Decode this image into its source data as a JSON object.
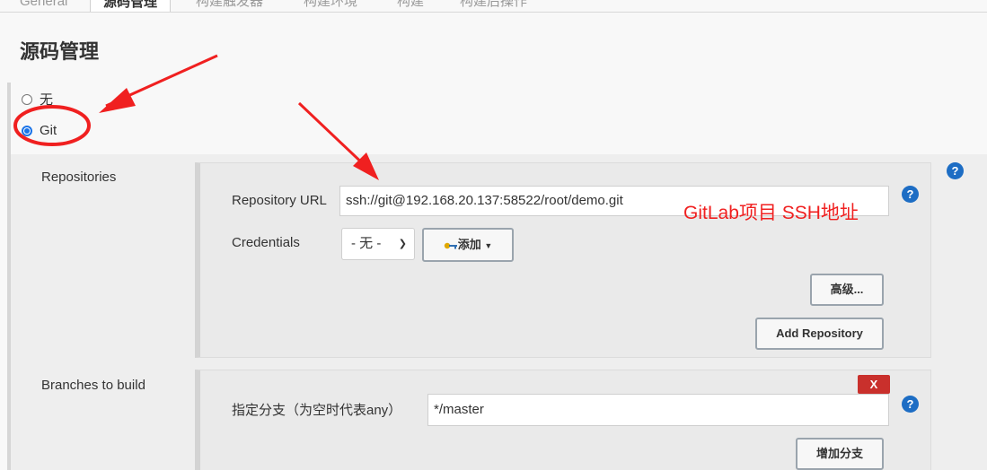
{
  "tabs": [
    {
      "label": "General",
      "active": false
    },
    {
      "label": "源码管理",
      "active": true
    },
    {
      "label": "构建触发器",
      "active": false
    },
    {
      "label": "构建环境",
      "active": false
    },
    {
      "label": "构建",
      "active": false
    },
    {
      "label": "构建后操作",
      "active": false
    }
  ],
  "section_title": "源码管理",
  "scm_options": [
    {
      "label": "无",
      "selected": false
    },
    {
      "label": "Git",
      "selected": true
    }
  ],
  "repositories": {
    "label": "Repositories",
    "url_label": "Repository URL",
    "url_value": "ssh://git@192.168.20.137:58522/root/demo.git",
    "credentials_label": "Credentials",
    "credentials_value": "- 无 -",
    "add_label": "添加",
    "advanced_label": "高级...",
    "add_repository_label": "Add Repository"
  },
  "branches": {
    "label": "Branches to build",
    "spec_label": "指定分支（为空时代表any）",
    "spec_value": "*/master",
    "add_branch_label": "增加分支",
    "delete_label": "X"
  },
  "help_icon_text": "?",
  "annotation_text": "GitLab项目 SSH地址",
  "colors": {
    "accent": "#1d6dc4",
    "annotation": "#f02020",
    "delete": "#c9302c"
  }
}
